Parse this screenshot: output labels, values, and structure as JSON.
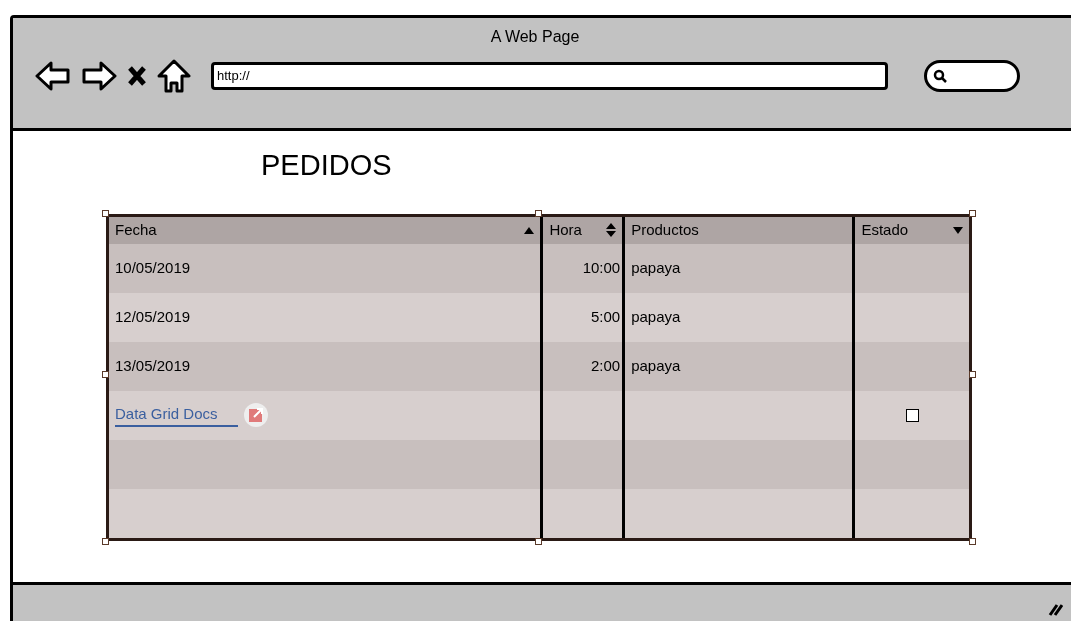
{
  "window": {
    "title": "A Web Page"
  },
  "toolbar": {
    "url": "http://"
  },
  "page": {
    "heading": "PEDIDOS"
  },
  "table": {
    "columns": [
      {
        "label": "Fecha",
        "kind": "ascending",
        "align_right": false
      },
      {
        "label": "Hora",
        "kind": "sortable",
        "align_right": true
      },
      {
        "label": "Productos",
        "kind": "plain",
        "align_right": false
      },
      {
        "label": "Estado",
        "kind": "descending",
        "align_right": false
      }
    ],
    "rows": [
      {
        "kind": "data",
        "cells": [
          "10/05/2019",
          "10:00",
          "papaya"
        ]
      },
      {
        "kind": "data",
        "cells": [
          "12/05/2019",
          "5:00",
          "papaya"
        ]
      },
      {
        "kind": "data",
        "cells": [
          "13/05/2019",
          "2:00",
          "papaya"
        ]
      },
      {
        "kind": "link",
        "link": "Data Grid Docs",
        "checked": false
      },
      {
        "kind": "empty"
      },
      {
        "kind": "empty"
      }
    ]
  }
}
